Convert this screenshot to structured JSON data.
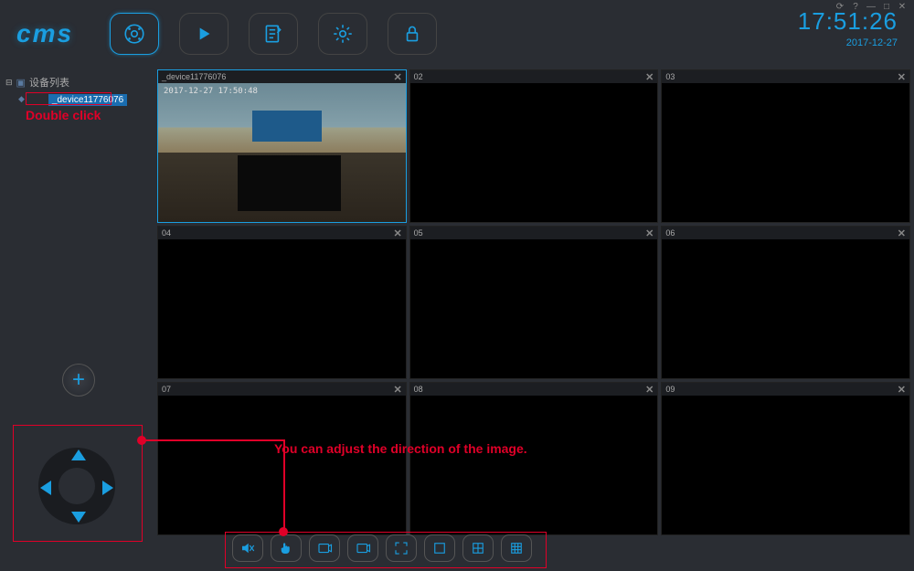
{
  "app": {
    "logo": "cms"
  },
  "clock": {
    "time": "17:51:26",
    "date": "2017-12-27"
  },
  "window_controls": {
    "refresh": "⟳",
    "help": "?",
    "min": "—",
    "max": "□",
    "close": "✕"
  },
  "tree": {
    "root_label": "设备列表",
    "items": [
      "_device11776076"
    ]
  },
  "annotations": {
    "double_click": "Double click",
    "direction": "You can adjust the direction of the image."
  },
  "add_button": "+",
  "grid": {
    "tiles": [
      {
        "label": "_device11776076",
        "active": true
      },
      {
        "label": "02"
      },
      {
        "label": "03"
      },
      {
        "label": "04"
      },
      {
        "label": "05"
      },
      {
        "label": "06"
      },
      {
        "label": "07"
      },
      {
        "label": "08"
      },
      {
        "label": "09"
      }
    ],
    "close_glyph": "✕",
    "osd": "2017-12-27  17:50:48"
  },
  "bottom_toolbar": [
    "mute",
    "hand",
    "export",
    "export2",
    "fullscreen",
    "layout-1",
    "layout-4",
    "layout-9"
  ]
}
